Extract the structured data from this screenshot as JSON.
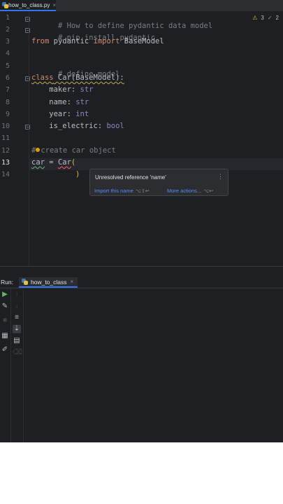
{
  "editor_tab": {
    "filename": "how_to_class.py",
    "close": "×"
  },
  "inspections": {
    "warnings": "3",
    "ok": "2"
  },
  "gutter": {
    "line_numbers": [
      "1",
      "2",
      "3",
      "4",
      "5",
      "6",
      "7",
      "8",
      "9",
      "10",
      "11",
      "12",
      "13",
      "14"
    ]
  },
  "code": {
    "l1": "# How to define pydantic data model",
    "l2": "# pip install pydantic",
    "l3_kw1": "from",
    "l3_mod": " pydantic ",
    "l3_kw2": "import",
    "l3_name": " BaseModel",
    "l5": "# define model",
    "l6_kw": "class",
    "l6_rest": " Car(BaseModel):",
    "l7_name": "    maker: ",
    "l7_type": "str",
    "l8_name": "    name: ",
    "l8_type": "str",
    "l9_name": "    year: ",
    "l9_type": "int",
    "l10_name": "    is_electric: ",
    "l10_type": "bool",
    "l12_hash": "#",
    "l12_rest": "create car object",
    "l13_var": "car",
    "l13_mid": " = ",
    "l13_call": "Car",
    "l13_paren": "(",
    "l14_paren": ")"
  },
  "popup": {
    "message": "Unresolved reference 'name'",
    "menu": "⋮",
    "action1": "Import this name",
    "action1_shortcut": "⌥⇧↩",
    "action2": "More actions...",
    "action2_shortcut": "⌥↩"
  },
  "run_panel": {
    "label": "Run:",
    "tab": "how_to_class",
    "close": "×"
  },
  "icons": {
    "left_toolbar": [
      "run-icon",
      "wrench-icon",
      "stop-icon",
      "layout-icon",
      "pin-icon"
    ],
    "right_toolbar": [
      "up-arrow-icon",
      "down-arrow-icon",
      "soft-wrap-icon",
      "scroll-to-end-icon",
      "print-icon",
      "trash-icon"
    ]
  },
  "colors": {
    "background": "#1e1f22",
    "keyword": "#cf8e6d",
    "comment": "#7a7e85",
    "type": "#8888c6",
    "accent": "#3574f0"
  }
}
